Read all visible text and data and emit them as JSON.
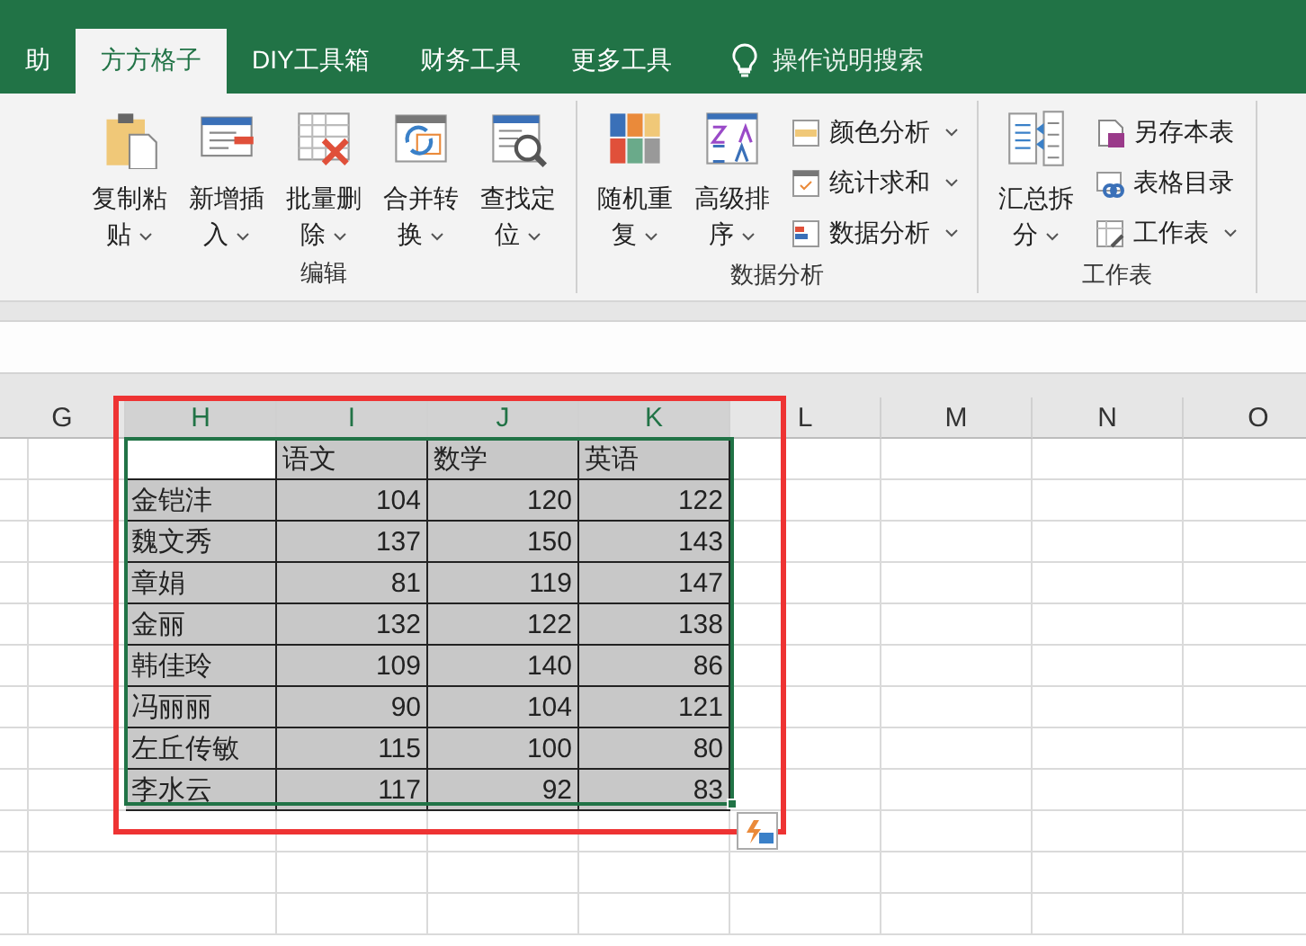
{
  "ribbon_tabs": [
    {
      "label": "助",
      "selected": false
    },
    {
      "label": "方方格子",
      "selected": true
    },
    {
      "label": "DIY工具箱",
      "selected": false
    },
    {
      "label": "财务工具",
      "selected": false
    },
    {
      "label": "更多工具",
      "selected": false
    }
  ],
  "tell_me": {
    "placeholder": "操作说明搜索"
  },
  "ribbon_groups": [
    {
      "title": "编辑",
      "items": [
        {
          "kind": "large",
          "label": "复制粘贴",
          "dropdown": true
        },
        {
          "kind": "large",
          "label": "新增插入",
          "dropdown": true
        },
        {
          "kind": "large",
          "label": "批量删除",
          "dropdown": true
        },
        {
          "kind": "large",
          "label": "合并转换",
          "dropdown": true
        },
        {
          "kind": "large",
          "label": "查找定位",
          "dropdown": true
        }
      ]
    },
    {
      "title": "数据分析",
      "items": [
        {
          "kind": "large",
          "label": "随机重复",
          "dropdown": true
        },
        {
          "kind": "large",
          "label": "高级排序",
          "dropdown": true
        },
        {
          "kind": "small",
          "label": "颜色分析",
          "dropdown": true
        },
        {
          "kind": "small",
          "label": "统计求和",
          "dropdown": true
        },
        {
          "kind": "small",
          "label": "数据分析",
          "dropdown": true
        }
      ]
    },
    {
      "title": "工作表",
      "items": [
        {
          "kind": "large",
          "label": "汇总拆分",
          "dropdown": true
        },
        {
          "kind": "small",
          "label": "另存本表",
          "dropdown": false
        },
        {
          "kind": "small",
          "label": "表格目录",
          "dropdown": false
        },
        {
          "kind": "small",
          "label": "工作表",
          "dropdown": true
        }
      ]
    }
  ],
  "sheet": {
    "columns": [
      {
        "label": "G",
        "selected": false
      },
      {
        "label": "H",
        "selected": true
      },
      {
        "label": "I",
        "selected": true
      },
      {
        "label": "J",
        "selected": true
      },
      {
        "label": "K",
        "selected": true
      },
      {
        "label": "L",
        "selected": false
      },
      {
        "label": "M",
        "selected": false
      },
      {
        "label": "N",
        "selected": false
      },
      {
        "label": "O",
        "selected": false
      }
    ],
    "headers": [
      "语文",
      "数学",
      "英语"
    ],
    "rows": [
      {
        "name": "金铠沣",
        "values": [
          "104",
          "120",
          "122"
        ]
      },
      {
        "name": "魏文秀",
        "values": [
          "137",
          "150",
          "143"
        ]
      },
      {
        "name": "章娟",
        "values": [
          "81",
          "119",
          "147"
        ]
      },
      {
        "name": "金丽",
        "values": [
          "132",
          "122",
          "138"
        ]
      },
      {
        "name": "韩佳玲",
        "values": [
          "109",
          "140",
          "86"
        ]
      },
      {
        "name": "冯丽丽",
        "values": [
          "90",
          "104",
          "121"
        ]
      },
      {
        "name": "左丘传敏",
        "values": [
          "115",
          "100",
          "80"
        ]
      },
      {
        "name": "李水云",
        "values": [
          "117",
          "92",
          "83"
        ]
      }
    ]
  }
}
